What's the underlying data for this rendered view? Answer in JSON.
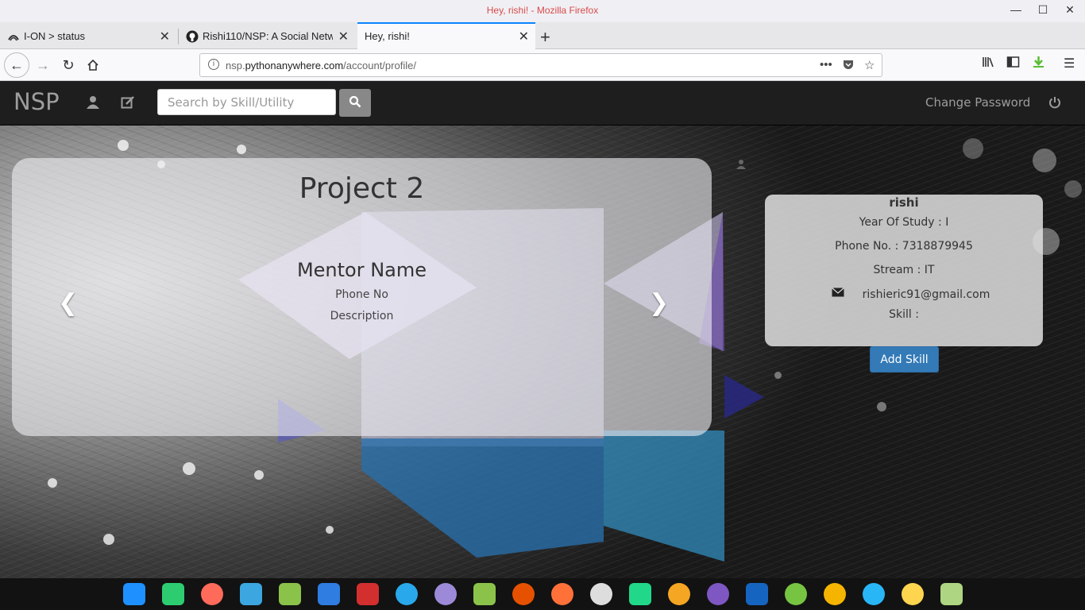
{
  "window": {
    "title": "Hey, rishi! - Mozilla Firefox"
  },
  "tabs": [
    {
      "label": "I-ON > status"
    },
    {
      "label": "Rishi110/NSP: A Social Netwo"
    },
    {
      "label": "Hey, rishi!"
    }
  ],
  "urlbar": {
    "prefix": "nsp.",
    "domain": "pythonanywhere.com",
    "path": "/account/profile/"
  },
  "app": {
    "brand": "NSP",
    "search_placeholder": "Search by Skill/Utility",
    "change_password": "Change Password"
  },
  "carousel": {
    "title": "Project 2",
    "mentor": "Mentor Name",
    "phone": "Phone No",
    "description": "Description"
  },
  "profile": {
    "name": "rishi",
    "year": "Year Of Study : I",
    "phone": "Phone No. : 7318879945",
    "stream": "Stream : IT",
    "email": "rishieric91@gmail.com",
    "skill": "Skill :",
    "add_skill": "Add Skill"
  },
  "colors": {
    "accent": "#337ab7",
    "navbar": "#1e1e1e",
    "tab_highlight": "#0a84ff"
  }
}
